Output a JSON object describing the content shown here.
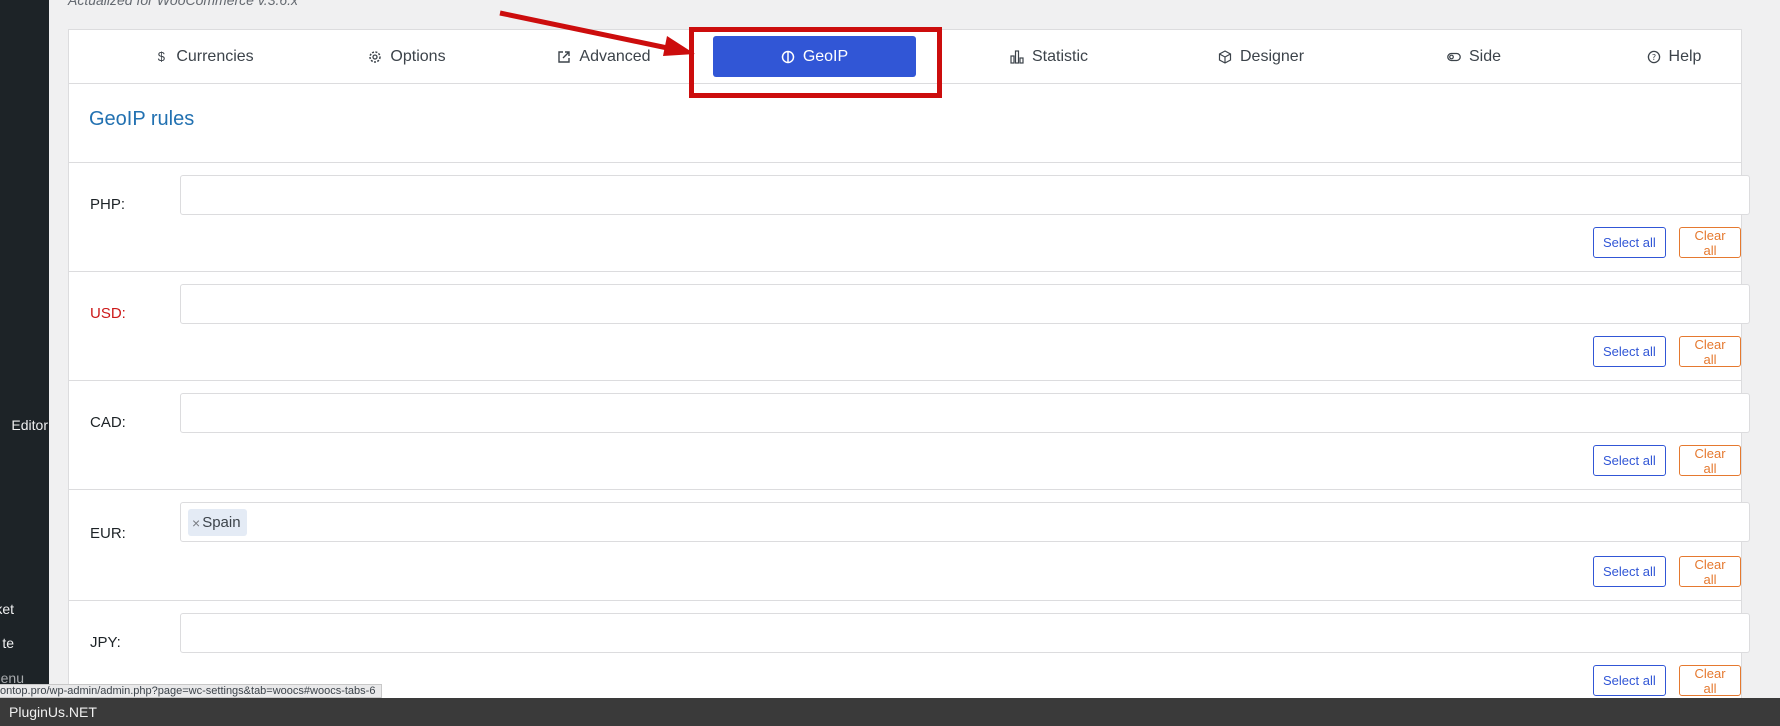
{
  "sidebar": {
    "editor_label": "Editor",
    "ket_label": "ket",
    "te_label": "te",
    "menu_label": "nenu"
  },
  "top_note": "Actualized for WooCommerce v.3.6.x",
  "tabs": [
    {
      "label": "Currencies",
      "icon": "dollar-icon"
    },
    {
      "label": "Options",
      "icon": "gear-icon"
    },
    {
      "label": "Advanced",
      "icon": "external-link-icon"
    },
    {
      "label": "GeoIP",
      "icon": "globe-icon",
      "active": true
    },
    {
      "label": "Statistic",
      "icon": "bar-chart-icon"
    },
    {
      "label": "Designer",
      "icon": "cube-icon"
    },
    {
      "label": "Side",
      "icon": "toggle-icon"
    },
    {
      "label": "Help",
      "icon": "question-circle-icon"
    }
  ],
  "section_title": "GeoIP rules",
  "rules": [
    {
      "currency": "PHP:",
      "countries": [],
      "highlight": false
    },
    {
      "currency": "USD:",
      "countries": [],
      "highlight": true
    },
    {
      "currency": "CAD:",
      "countries": [],
      "highlight": false
    },
    {
      "currency": "EUR:",
      "countries": [
        "Spain"
      ],
      "highlight": false
    },
    {
      "currency": "JPY:",
      "countries": [],
      "highlight": false
    }
  ],
  "buttons": {
    "select_all": "Select all",
    "clear_all": "Clear all"
  },
  "tag_remove": "×",
  "url_tooltip": "ontop.pro/wp-admin/admin.php?page=wc-settings&tab=woocs#woocs-tabs-6",
  "footer": "PluginUs.NET",
  "colors": {
    "accent": "#3156d6",
    "highlight_red": "#cc0d0d",
    "clear_orange": "#e5792f",
    "title_blue": "#2271b1",
    "usd_red": "#cc1818"
  }
}
